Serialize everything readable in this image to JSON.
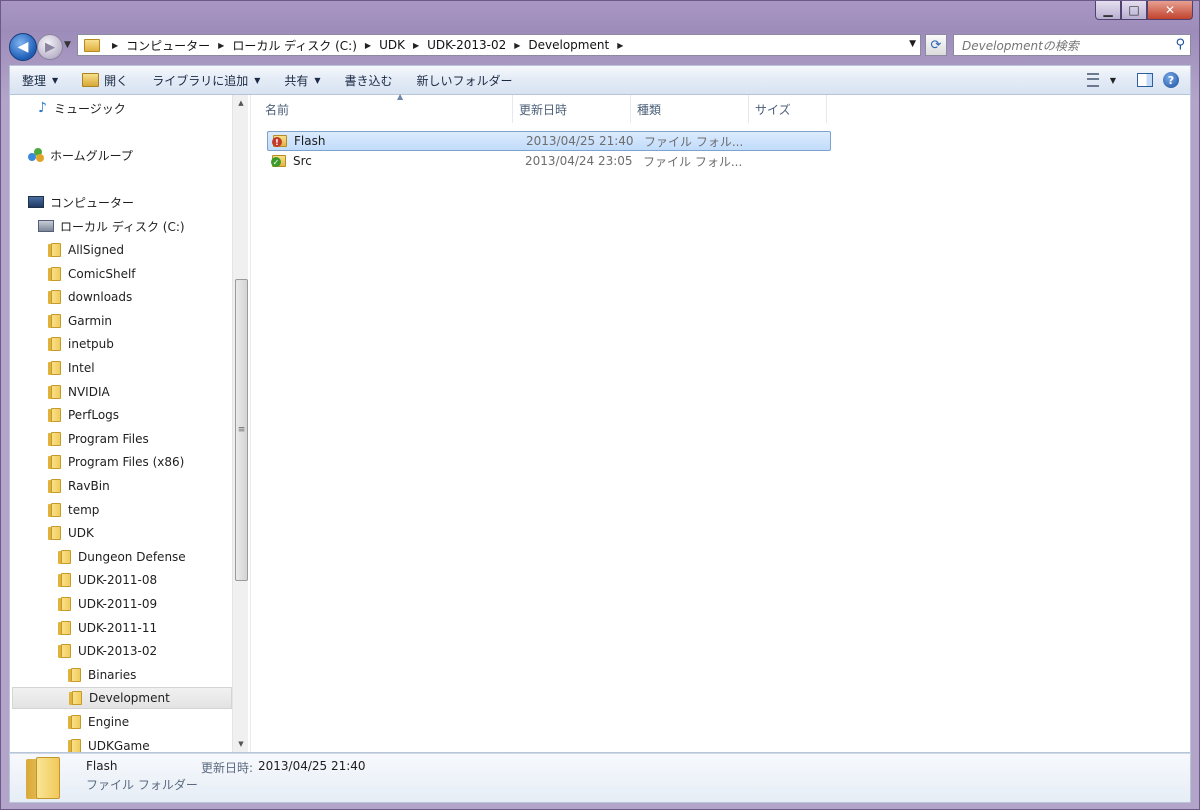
{
  "window": {
    "minimize": "▁",
    "maximize": "□",
    "close": "✕"
  },
  "nav": {
    "back_glyph": "◀",
    "forward_glyph": "▶",
    "breadcrumbs": [
      "コンピューター",
      "ローカル ディスク (C:)",
      "UDK",
      "UDK-2013-02",
      "Development"
    ],
    "search_placeholder": "Developmentの検索"
  },
  "toolbar": {
    "organize": "整理",
    "open": "開く",
    "add_to_library": "ライブラリに追加",
    "share": "共有",
    "burn": "書き込む",
    "new_folder": "新しいフォルダー",
    "help": "?"
  },
  "sidebar": {
    "music": "ミュージック",
    "homegroup": "ホームグループ",
    "computer": "コンピューター",
    "local_disk": "ローカル ディスク (C:)",
    "folders": [
      {
        "label": "AllSigned",
        "level": 1
      },
      {
        "label": "ComicShelf",
        "level": 1
      },
      {
        "label": "downloads",
        "level": 1
      },
      {
        "label": "Garmin",
        "level": 1
      },
      {
        "label": "inetpub",
        "level": 1
      },
      {
        "label": "Intel",
        "level": 1
      },
      {
        "label": "NVIDIA",
        "level": 1
      },
      {
        "label": "PerfLogs",
        "level": 1
      },
      {
        "label": "Program Files",
        "level": 1
      },
      {
        "label": "Program Files (x86)",
        "level": 1
      },
      {
        "label": "RavBin",
        "level": 1
      },
      {
        "label": "temp",
        "level": 1
      },
      {
        "label": "UDK",
        "level": 1
      },
      {
        "label": "Dungeon Defense",
        "level": 2
      },
      {
        "label": "UDK-2011-08",
        "level": 2
      },
      {
        "label": "UDK-2011-09",
        "level": 2
      },
      {
        "label": "UDK-2011-11",
        "level": 2
      },
      {
        "label": "UDK-2013-02",
        "level": 2
      },
      {
        "label": "Binaries",
        "level": 3
      },
      {
        "label": "Development",
        "level": 3,
        "selected": true
      },
      {
        "label": "Engine",
        "level": 3
      },
      {
        "label": "UDKGame",
        "level": 3
      }
    ]
  },
  "columns": [
    "名前",
    "更新日時",
    "種類",
    "サイズ"
  ],
  "files": [
    {
      "name": "Flash",
      "modified": "2013/04/25 21:40",
      "type": "ファイル フォル...",
      "size": "",
      "status": "conflict",
      "selected": true
    },
    {
      "name": "Src",
      "modified": "2013/04/24 23:05",
      "type": "ファイル フォル...",
      "size": "",
      "status": "ok",
      "selected": false
    }
  ],
  "details": {
    "name": "Flash",
    "type": "ファイル フォルダー",
    "date_label": "更新日時:",
    "date": "2013/04/25 21:40"
  },
  "colors": {
    "conflict_badge": "#c0392b",
    "ok_badge": "#3a9b2a",
    "selection": "#c1dcfc"
  }
}
